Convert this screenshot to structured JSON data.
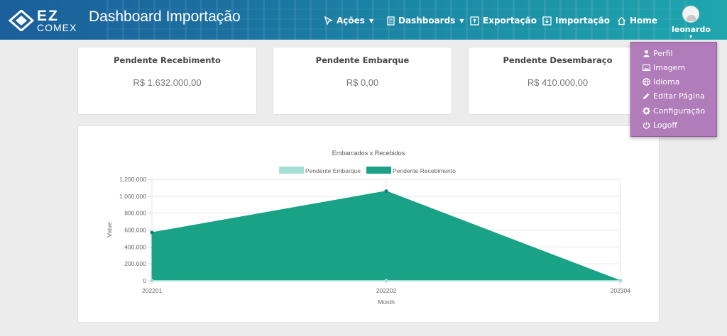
{
  "app": {
    "logo_top": "EZ",
    "logo_bottom": "COMEX",
    "title": "Dashboard Importação"
  },
  "nav": {
    "acoes": "Ações",
    "dashboards": "Dashboards",
    "exportacao": "Exportação",
    "importacao": "Importação",
    "home": "Home",
    "user": "leonardo"
  },
  "cards": [
    {
      "title": "Pendente Recebimento",
      "value": "R$ 1.632.000,00"
    },
    {
      "title": "Pendente Embarque",
      "value": "R$ 0,00"
    },
    {
      "title": "Pendente Desembaraço",
      "value": "R$ 410.000,00"
    }
  ],
  "user_menu": {
    "perfil": "Perfil",
    "imagem": "Imagem",
    "idioma": "Idioma",
    "editar": "Editar Página",
    "configuracao": "Configuração",
    "logoff": "Logoff"
  },
  "chart_data": {
    "type": "area",
    "title": "Embarcados x Recebidos",
    "xlabel": "Month",
    "ylabel": "Value",
    "categories": [
      "202201",
      "202202",
      "202304"
    ],
    "ylim": [
      0,
      1200000
    ],
    "yticks": [
      0,
      200000,
      400000,
      600000,
      800000,
      1000000,
      1200000
    ],
    "ytick_labels": [
      "0",
      "200.000",
      "400.000",
      "600.000",
      "800.000",
      "1.000.000",
      "1.200.000"
    ],
    "legend_position": "top",
    "grid": true,
    "series": [
      {
        "name": "Pendente Embarque",
        "values": [
          0,
          0,
          0
        ],
        "color": "#a6dfd3"
      },
      {
        "name": "Pendente Recebimento",
        "values": [
          570000,
          1060000,
          0
        ],
        "color": "#1aa287"
      }
    ]
  }
}
